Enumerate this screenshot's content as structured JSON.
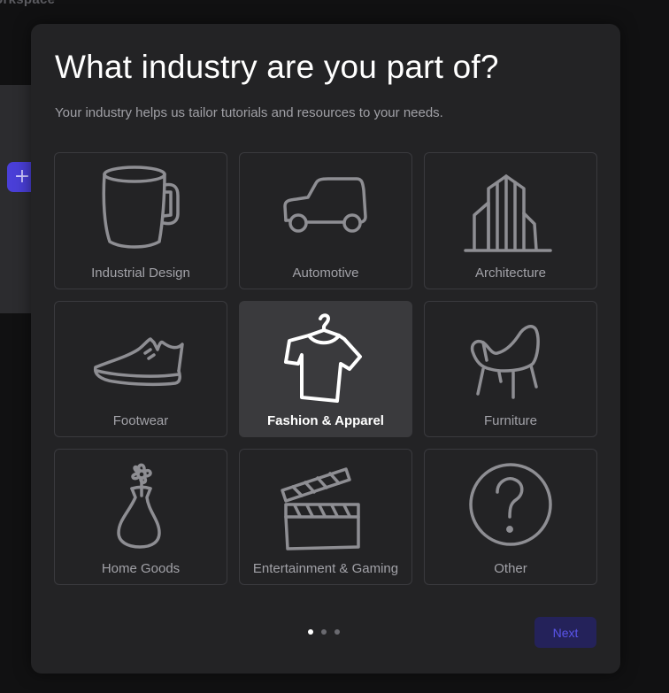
{
  "background": {
    "topbar_text": "orkspace",
    "add_button_label": "+"
  },
  "modal": {
    "title": "What industry are you part of?",
    "subtitle": "Your industry helps us tailor tutorials and resources to your needs.",
    "options": [
      {
        "label": "Industrial Design",
        "icon": "mug-icon",
        "selected": false
      },
      {
        "label": "Automotive",
        "icon": "car-icon",
        "selected": false
      },
      {
        "label": "Architecture",
        "icon": "building-icon",
        "selected": false
      },
      {
        "label": "Footwear",
        "icon": "shoe-icon",
        "selected": false
      },
      {
        "label": "Fashion & Apparel",
        "icon": "shirt-on-hanger-icon",
        "selected": true
      },
      {
        "label": "Furniture",
        "icon": "chair-icon",
        "selected": false
      },
      {
        "label": "Home Goods",
        "icon": "flower-vase-icon",
        "selected": false
      },
      {
        "label": "Entertainment & Gaming",
        "icon": "clapperboard-icon",
        "selected": false
      },
      {
        "label": "Other",
        "icon": "question-mark-icon",
        "selected": false
      }
    ],
    "pagination": {
      "total": 3,
      "current": 1
    },
    "next_label": "Next"
  },
  "colors": {
    "accent": "#4a3fd8",
    "next_bg": "#24225a",
    "next_text": "#5a54ea",
    "card_selected": "#3a3a3d"
  }
}
